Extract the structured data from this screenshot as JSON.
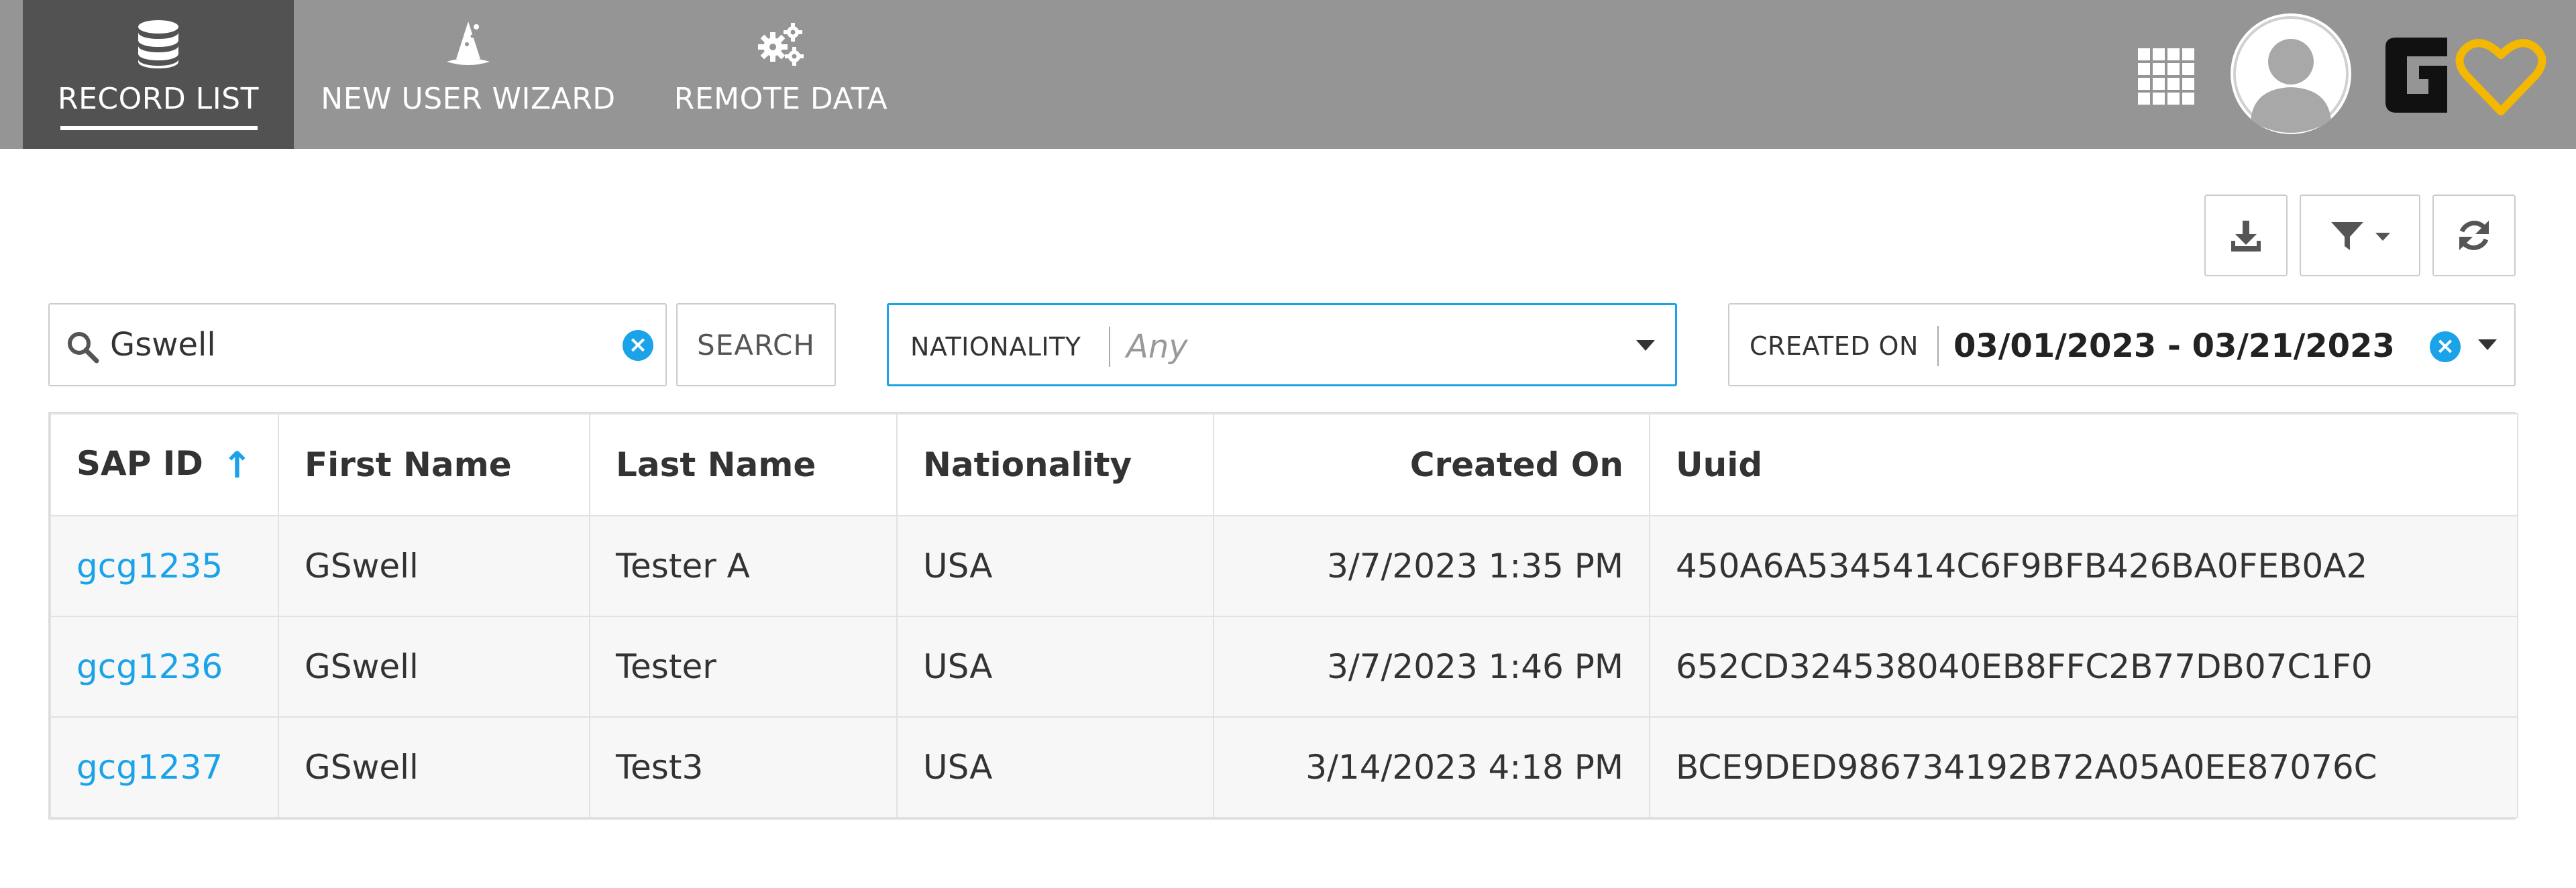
{
  "nav": {
    "tabs": [
      {
        "label": "RECORD LIST",
        "icon": "database-icon",
        "active": true
      },
      {
        "label": "NEW USER WIZARD",
        "icon": "wizard-hat-icon",
        "active": false
      },
      {
        "label": "REMOTE DATA",
        "icon": "gears-icon",
        "active": false
      }
    ]
  },
  "header": {
    "apps_icon": "grid-apps-icon",
    "avatar_icon": "user-silhouette-icon",
    "logo_icon": "brand-logo-heart-icon",
    "logo_accent": "#f5b800"
  },
  "toolbar": {
    "download_icon": "download-icon",
    "filter_icon": "funnel-icon",
    "refresh_icon": "refresh-icon"
  },
  "search": {
    "value": "Gswell",
    "button_label": "SEARCH"
  },
  "filters": {
    "nationality": {
      "label": "NATIONALITY",
      "value": "Any"
    },
    "created_on": {
      "label": "CREATED ON",
      "value": "03/01/2023 - 03/21/2023"
    }
  },
  "table": {
    "columns": [
      "SAP ID",
      "First Name",
      "Last Name",
      "Nationality",
      "Created On",
      "Uuid"
    ],
    "sort_column": "SAP ID",
    "sort_direction": "ascending",
    "rows": [
      {
        "sap_id": "gcg1235",
        "first_name": "GSwell",
        "last_name": "Tester A",
        "nationality": "USA",
        "created_on": "3/7/2023 1:35 PM",
        "uuid": "450A6A5345414C6F9BFB426BA0FEB0A2"
      },
      {
        "sap_id": "gcg1236",
        "first_name": "GSwell",
        "last_name": "Tester",
        "nationality": "USA",
        "created_on": "3/7/2023 1:46 PM",
        "uuid": "652CD324538040EB8FFC2B77DB07C1F0"
      },
      {
        "sap_id": "gcg1237",
        "first_name": "GSwell",
        "last_name": "Test3",
        "nationality": "USA",
        "created_on": "3/14/2023 4:18 PM",
        "uuid": "BCE9DED986734192B72A05A0EE87076C"
      }
    ]
  },
  "colors": {
    "header_bg": "#959595",
    "active_tab_bg": "#525252",
    "accent": "#1aa3e8"
  }
}
